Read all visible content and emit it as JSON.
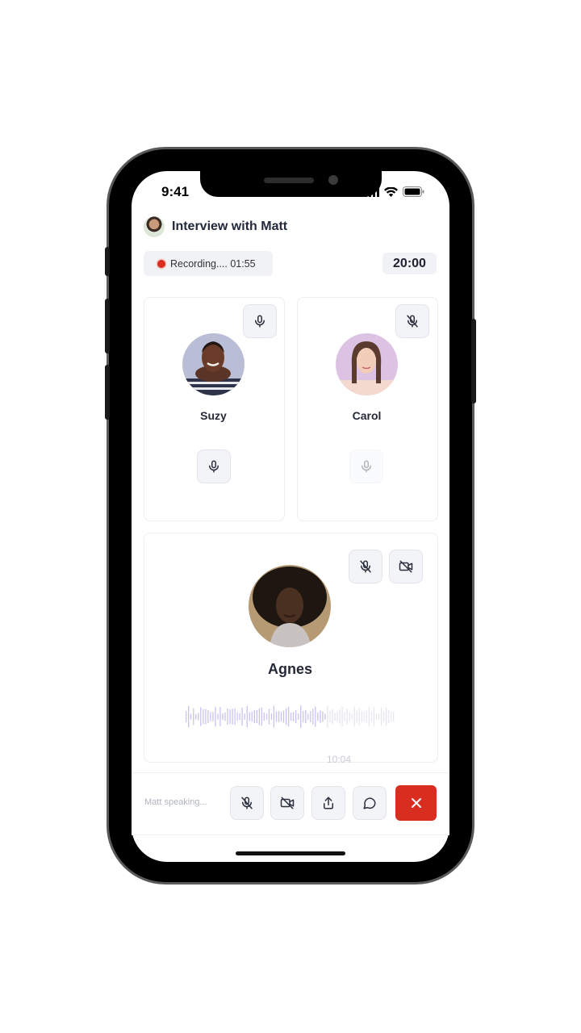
{
  "status_bar": {
    "time": "9:41"
  },
  "header": {
    "title": "Interview with Matt"
  },
  "recording": {
    "label": "Recording.... 01:55"
  },
  "timer": {
    "value": "20:00"
  },
  "participants": [
    {
      "name": "Suzy",
      "top_icon": "mic-icon",
      "bottom_icon": "mic-icon"
    },
    {
      "name": "Carol",
      "top_icon": "mic-off-icon",
      "bottom_icon": "mic-icon"
    },
    {
      "name": "Agnes",
      "icons": [
        "mic-off-icon",
        "video-off-icon"
      ]
    }
  ],
  "waveform": {
    "elapsed": "10:04",
    "progress": 0.68
  },
  "bottom_bar": {
    "speaking_label": "Matt speaking...",
    "controls": [
      "mic-off-icon",
      "video-off-icon",
      "share-icon",
      "chat-icon",
      "close-icon"
    ]
  },
  "colors": {
    "accent_red": "#d92d20",
    "wave": "#c9c3f2",
    "pill_bg": "#f1f2f6"
  }
}
